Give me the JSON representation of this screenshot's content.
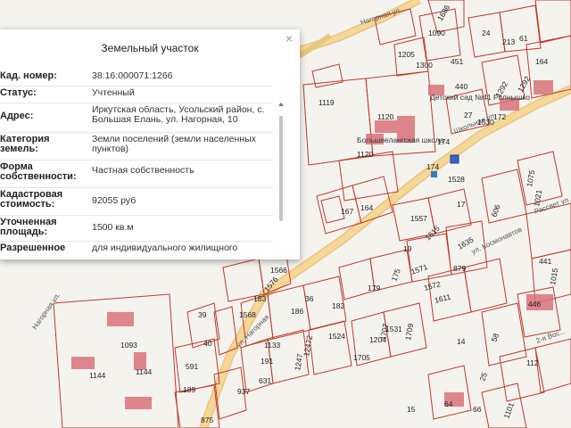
{
  "popup": {
    "title": "Земельный участок",
    "rows": [
      {
        "key": "Кад. номер:",
        "value": "38:16:000071:1266"
      },
      {
        "key": "Статус:",
        "value": "Учтенный"
      },
      {
        "key": "Адрес:",
        "value": "Иркутская область, Усольский район, с. Большая Елань, ул. Нагорная, 10"
      },
      {
        "key": "Категория земель:",
        "value": "Земли поселений (земли населенных пунктов)"
      },
      {
        "key": "Форма собственности:",
        "value": "Частная собственность"
      },
      {
        "key": "Кадастровая стоимость:",
        "value": "92055 руб"
      },
      {
        "key": "Уточненная площадь:",
        "value": "1500 кв.м"
      },
      {
        "key": "Разрешенное",
        "value": "для индивидуального жилищного"
      }
    ]
  },
  "map": {
    "streets": [
      "Нагорная ул.",
      "Нагорная ул.",
      "Школьная ул.",
      "ул. Нагорная",
      "ул. Космонавтов",
      "Рассвет ул.",
      "2-я Вос..."
    ],
    "school_label": "Большеелангская школа",
    "kindergarten_label": "Детский сад №41 Ролнышко",
    "parcels": [
      "1686",
      "1090",
      "1205",
      "1300",
      "451",
      "440",
      "24",
      "172",
      "164",
      "213",
      "61",
      "1292",
      "1292",
      "174",
      "1528",
      "1530",
      "1119",
      "1120",
      "1120",
      "174",
      "27",
      "1075",
      "1021",
      "606",
      "17",
      "1557",
      "1615",
      "1635",
      "879",
      "1571",
      "1572",
      "1611",
      "19",
      "175",
      "179",
      "182",
      "1709",
      "1705",
      "1204",
      "1531",
      "1524",
      "1133",
      "1568",
      "1576",
      "1566",
      "183",
      "186",
      "36",
      "39",
      "40",
      "191",
      "631",
      "937",
      "189",
      "591",
      "1093",
      "1144",
      "1144",
      "875",
      "167",
      "164",
      "441",
      "1015",
      "446",
      "1101",
      "25",
      "58",
      "14",
      "112",
      "64",
      "66",
      "15",
      "1707",
      "1247",
      "12472"
    ]
  },
  "colors": {
    "road": "#f5c77a",
    "parcel_line": "#c0392b",
    "building": "#d9727a",
    "popup_bg": "#ffffff"
  }
}
